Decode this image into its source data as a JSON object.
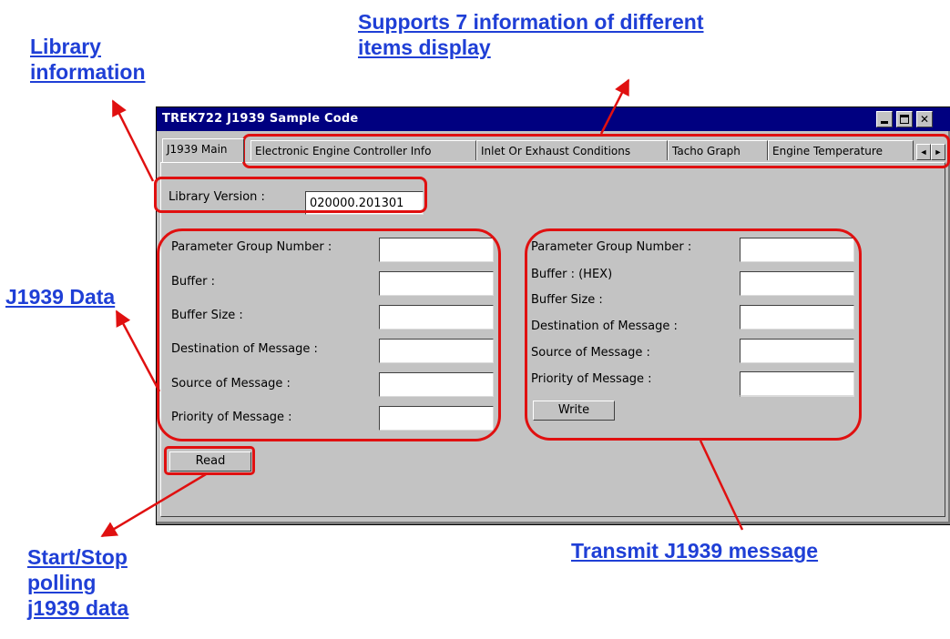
{
  "annotations": {
    "library_information": "Library\ninformation",
    "supports_tabs": "Supports 7 information of different\nitems display",
    "j1939_data": "J1939 Data",
    "start_stop": "Start/Stop\npolling\nj1939 data",
    "transmit": "Transmit J1939 message"
  },
  "window": {
    "title": "TREK722 J1939 Sample Code",
    "controls": {
      "minimize": "minimize",
      "maximize": "maximize",
      "close": "✕"
    }
  },
  "tabs": [
    {
      "label": "J1939 Main",
      "active": true
    },
    {
      "label": "Electronic Engine Controller Info"
    },
    {
      "label": "Inlet Or Exhaust Conditions"
    },
    {
      "label": "Tacho Graph"
    },
    {
      "label": "Engine Temperature"
    }
  ],
  "scroll": {
    "left": "◄",
    "right": "►"
  },
  "library": {
    "label": "Library Version :",
    "value": "020000.201301"
  },
  "receive": {
    "fields": [
      {
        "label": "Parameter Group Number :",
        "value": ""
      },
      {
        "label": "Buffer :",
        "value": ""
      },
      {
        "label": "Buffer Size :",
        "value": ""
      },
      {
        "label": "Destination of Message :",
        "value": ""
      },
      {
        "label": "Source of Message :",
        "value": ""
      },
      {
        "label": "Priority of Message :",
        "value": ""
      }
    ],
    "button": "Read"
  },
  "transmit": {
    "fields": [
      {
        "label": "Parameter Group Number :",
        "value": ""
      },
      {
        "label": "Buffer : (HEX)",
        "value": ""
      },
      {
        "label": "Buffer Size :",
        "value": ""
      },
      {
        "label": "Destination of Message :",
        "value": ""
      },
      {
        "label": "Source of Message :",
        "value": ""
      },
      {
        "label": "Priority of Message :",
        "value": ""
      }
    ],
    "button": "Write"
  },
  "colors": {
    "annotation_text": "#1f3fd6",
    "highlight": "#e01010",
    "titlebar": "#000080",
    "window_bg": "#c3c3c3"
  }
}
